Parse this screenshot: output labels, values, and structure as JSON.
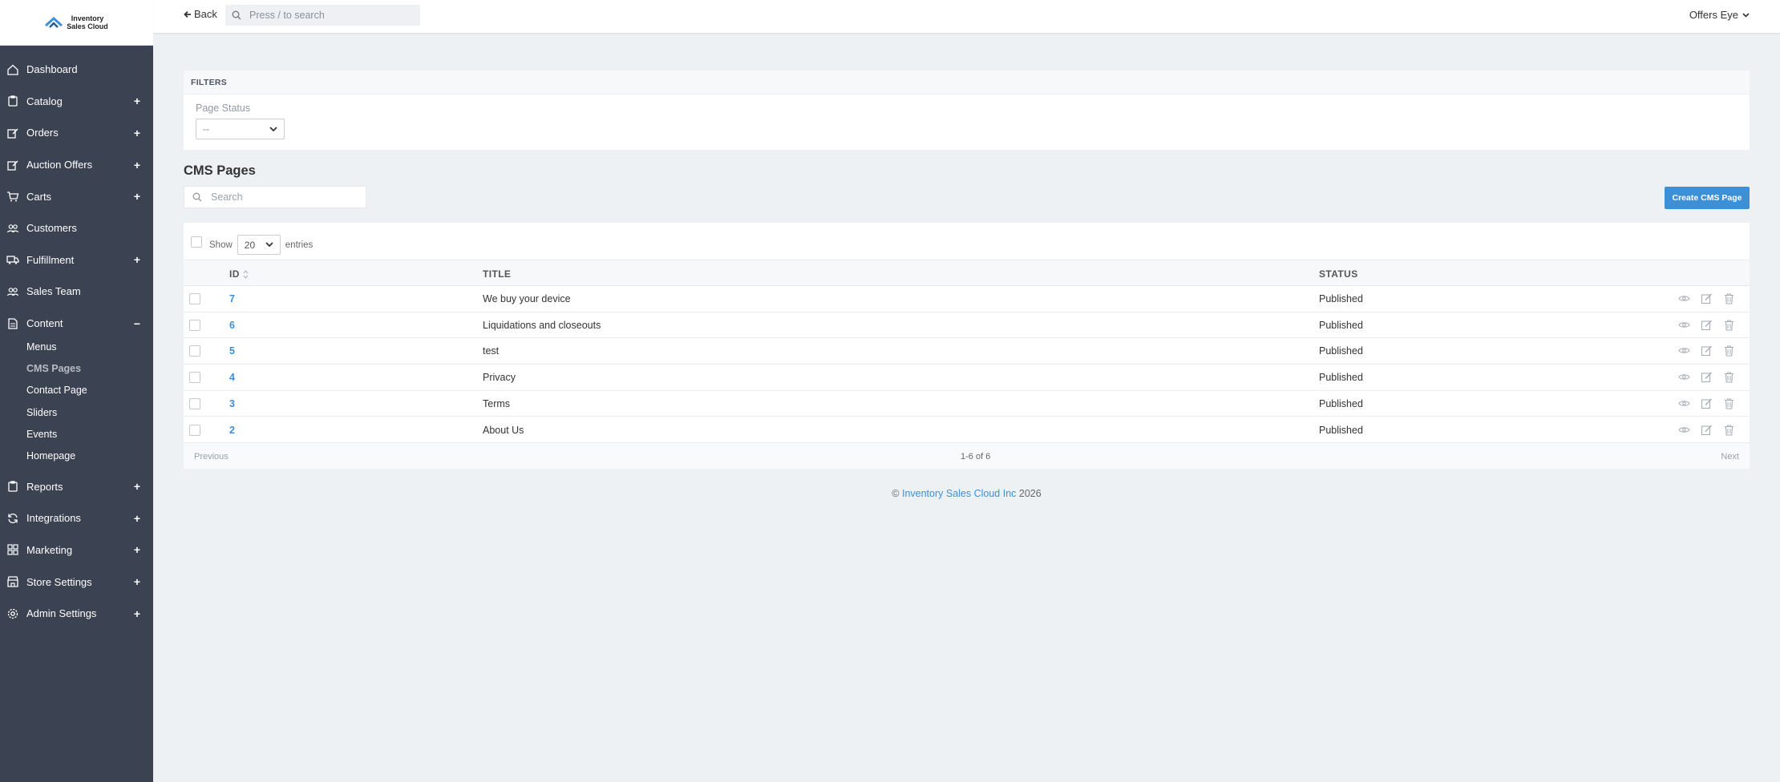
{
  "brand": {
    "logo_line1": "Inventory",
    "logo_line2": "Sales Cloud",
    "color": "#3d8fd6"
  },
  "topbar": {
    "back_label": "Back",
    "search_placeholder": "Press / to search",
    "user_name": "Offers Eye"
  },
  "sidebar": {
    "items": [
      {
        "label": "Dashboard",
        "icon": "home-icon",
        "toggle": ""
      },
      {
        "label": "Catalog",
        "icon": "clipboard-icon",
        "toggle": "+"
      },
      {
        "label": "Orders",
        "icon": "edit-icon",
        "toggle": "+"
      },
      {
        "label": "Auction Offers",
        "icon": "edit-icon",
        "toggle": "+"
      },
      {
        "label": "Carts",
        "icon": "cart-icon",
        "toggle": "+"
      },
      {
        "label": "Customers",
        "icon": "users-icon",
        "toggle": ""
      },
      {
        "label": "Fulfillment",
        "icon": "truck-icon",
        "toggle": "+"
      },
      {
        "label": "Sales Team",
        "icon": "users-icon",
        "toggle": ""
      },
      {
        "label": "Content",
        "icon": "file-icon",
        "toggle": "−"
      }
    ],
    "content_sub": [
      "Menus",
      "CMS Pages",
      "Contact Page",
      "Sliders",
      "Events",
      "Homepage"
    ],
    "items_after": [
      {
        "label": "Reports",
        "icon": "clipboard-icon",
        "toggle": "+"
      },
      {
        "label": "Integrations",
        "icon": "refresh-icon",
        "toggle": "+"
      },
      {
        "label": "Marketing",
        "icon": "grid-icon",
        "toggle": "+"
      },
      {
        "label": "Store Settings",
        "icon": "store-icon",
        "toggle": "+"
      },
      {
        "label": "Admin Settings",
        "icon": "gear-icon",
        "toggle": "+"
      }
    ]
  },
  "filters": {
    "heading": "FILTERS",
    "page_status_label": "Page Status",
    "page_status_value": "--"
  },
  "cms": {
    "title": "CMS Pages",
    "search_placeholder": "Search",
    "create_label": "Create CMS Page",
    "show_label": "Show",
    "entries_value": "20",
    "entries_label": "entries",
    "columns": {
      "id": "ID",
      "title": "TITLE",
      "status": "STATUS"
    },
    "rows": [
      {
        "id": "7",
        "title": "We buy your device",
        "status": "Published"
      },
      {
        "id": "6",
        "title": "Liquidations and closeouts",
        "status": "Published"
      },
      {
        "id": "5",
        "title": "test",
        "status": "Published"
      },
      {
        "id": "4",
        "title": "Privacy",
        "status": "Published"
      },
      {
        "id": "3",
        "title": "Terms",
        "status": "Published"
      },
      {
        "id": "2",
        "title": "About Us",
        "status": "Published"
      }
    ],
    "pager": {
      "previous": "Previous",
      "info": "1-6 of 6",
      "next": "Next"
    }
  },
  "footer": {
    "copyright": "©",
    "company": "Inventory Sales Cloud Inc",
    "year": "2026"
  }
}
